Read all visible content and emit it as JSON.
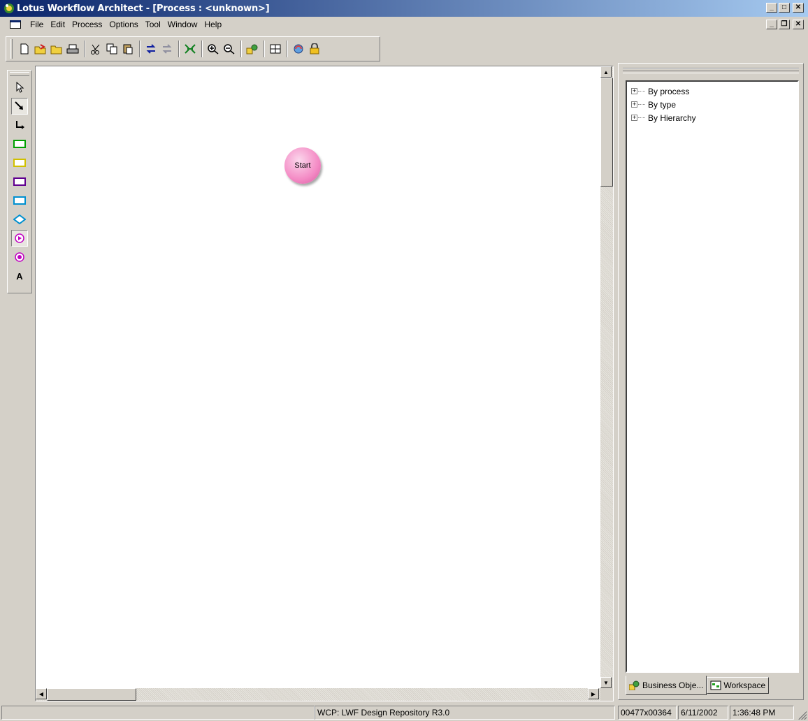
{
  "window": {
    "title": "Lotus Workflow Architect - [Process : <unknown>]"
  },
  "menu": {
    "items": [
      "File",
      "Edit",
      "Process",
      "Options",
      "Tool",
      "Window",
      "Help"
    ]
  },
  "toolbar": {
    "icons": [
      "new-icon",
      "open-icon",
      "open-folder-icon",
      "print-icon",
      "cut-icon",
      "copy-icon",
      "paste-icon",
      "undo-icon",
      "redo-icon",
      "fit-icon",
      "zoom-in-icon",
      "zoom-out-icon",
      "business-objects-icon",
      "grid-icon",
      "refresh-icon",
      "lock-icon"
    ]
  },
  "palette": {
    "tools": [
      "pointer-tool",
      "connector-tool",
      "elbow-connector-tool",
      "activity-green-tool",
      "activity-yellow-tool",
      "activity-purple-tool",
      "activity-blue-tool",
      "decision-tool",
      "start-tool",
      "end-tool",
      "text-tool"
    ],
    "text_tool_label": "A"
  },
  "canvas": {
    "start_node_label": "Start"
  },
  "tree": {
    "items": [
      "By process",
      "By type",
      "By Hierarchy"
    ]
  },
  "tabs": {
    "business_objects": "Business Obje...",
    "workspace": "Workspace"
  },
  "status": {
    "repository": "WCP: LWF Design Repository R3.0",
    "size": "00477x00364",
    "date": "6/11/2002",
    "time": "1:36:48 PM"
  },
  "colors": {
    "titlebar": "#0a246a",
    "start_node": "#f48bc5",
    "face": "#d4d0c8"
  }
}
